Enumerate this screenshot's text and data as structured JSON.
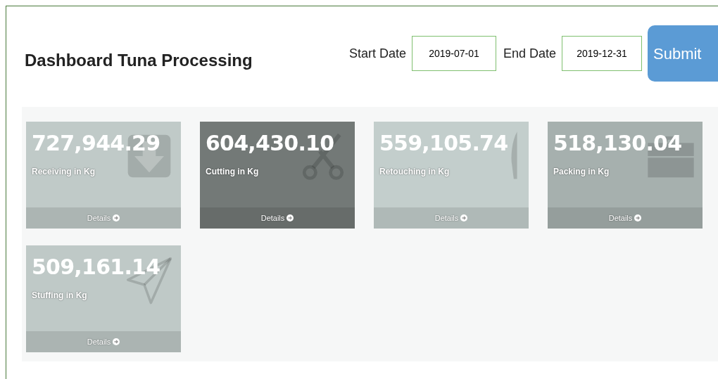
{
  "title": "Dashboard Tuna Processing",
  "filters": {
    "start_label": "Start Date",
    "start_value": "2019-07-01",
    "end_label": "End Date",
    "end_value": "2019-12-31",
    "submit": "Submit"
  },
  "cards": [
    {
      "value": "727,944.29",
      "label": "Receiving in Kg",
      "details": "Details",
      "color": "#c0cac8"
    },
    {
      "value": "604,430.10",
      "label": "Cutting in Kg",
      "details": "Details",
      "color": "#737977"
    },
    {
      "value": "559,105.74",
      "label": "Retouching in Kg",
      "details": "Details",
      "color": "#c3cecc"
    },
    {
      "value": "518,130.04",
      "label": "Packing in Kg",
      "details": "Details",
      "color": "#a6b0ae"
    },
    {
      "value": "509,161.14",
      "label": "Stuffing in Kg",
      "details": "Details",
      "color": "#bfc9c7"
    }
  ]
}
